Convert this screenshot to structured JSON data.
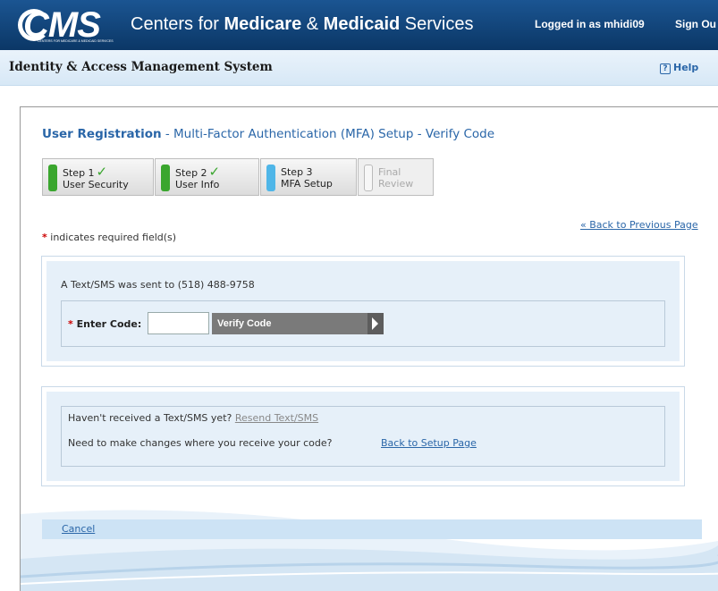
{
  "header": {
    "logo_text": "CMS",
    "logo_subtext": "CENTERS FOR MEDICARE & MEDICAID SERVICES",
    "org_prefix": "Centers for ",
    "org_medicare": "Medicare",
    "org_amp": " & ",
    "org_medicaid": "Medicaid",
    "org_suffix": " Services",
    "logged_in": "Logged in as mhidi09",
    "sign_out": "Sign Ou",
    "brand_color": "#0b3766"
  },
  "subheader": {
    "title": "Identity & Access Management System",
    "help_icon": "?",
    "help_label": "Help"
  },
  "page": {
    "title_bold": "User Registration",
    "title_rest": " - Multi-Factor Authentication (MFA) Setup - Verify Code",
    "back_previous": "« Back to Previous Page",
    "required_star": "*",
    "required_note": " indicates required field(s)"
  },
  "steps": [
    {
      "line1": "Step 1",
      "line2": "User Security",
      "status": "complete",
      "color": "#3aa62e",
      "check": "✓"
    },
    {
      "line1": "Step 2",
      "line2": "User Info",
      "status": "complete",
      "color": "#3aa62e",
      "check": "✓"
    },
    {
      "line1": "Step 3",
      "line2": "MFA Setup",
      "status": "current",
      "color": "#4fb6e8",
      "check": ""
    },
    {
      "line1": "Final",
      "line2": "Review",
      "status": "pending",
      "color": "#f2f2f2",
      "check": ""
    }
  ],
  "verify": {
    "sms_sent": "A Text/SMS was sent to (518) 488-9758",
    "code_star": "*",
    "code_label": " Enter Code:",
    "code_value": "",
    "button_label": "Verify Code"
  },
  "resend": {
    "not_received": "Haven't received a Text/SMS yet? ",
    "resend_link": "Resend Text/SMS",
    "change_prompt": "Need to make changes where you receive your code?",
    "back_setup": "Back to Setup Page"
  },
  "footer": {
    "cancel": "Cancel"
  }
}
